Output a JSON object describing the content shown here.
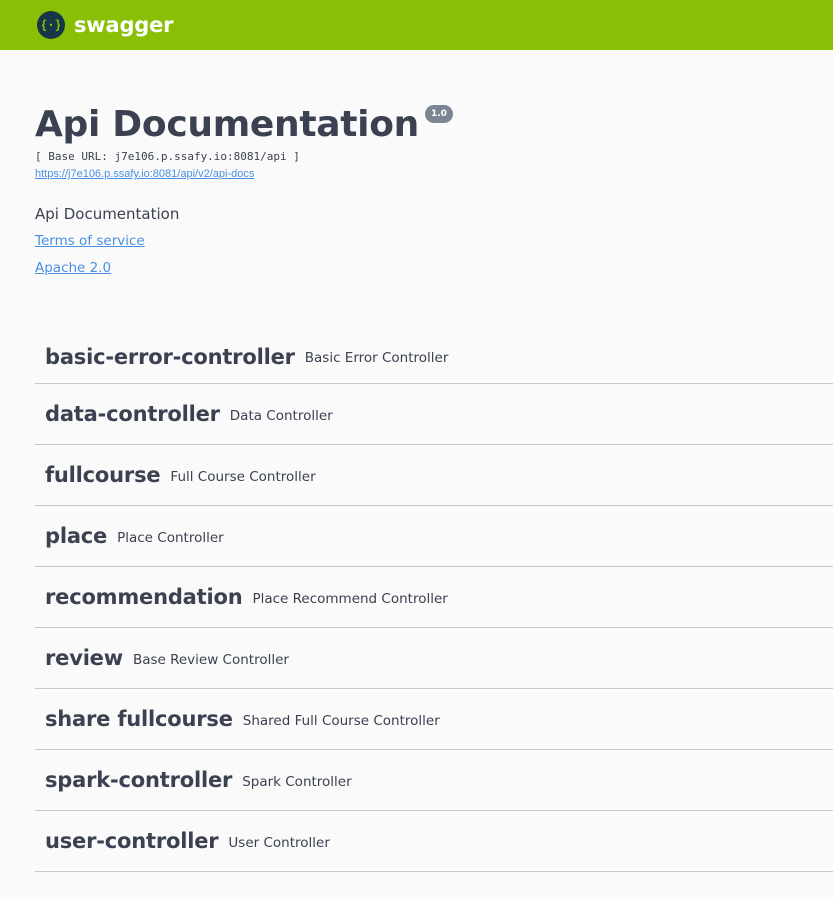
{
  "topbar": {
    "brand": "swagger",
    "logo_icon": "swagger-braces-icon",
    "colors": {
      "bar": "#89bf04",
      "logo_circle": "#173647"
    }
  },
  "info": {
    "title": "Api Documentation",
    "version": "1.0",
    "base_url": "[ Base URL: j7e106.p.ssafy.io:8081/api ]",
    "api_docs_url": "https://j7e106.p.ssafy.io:8081/api/v2/api-docs",
    "description": "Api Documentation",
    "terms_label": "Terms of service",
    "license_label": "Apache 2.0"
  },
  "tags": [
    {
      "name": "basic-error-controller",
      "description": "Basic Error Controller"
    },
    {
      "name": "data-controller",
      "description": "Data Controller"
    },
    {
      "name": "fullcourse",
      "description": "Full Course Controller"
    },
    {
      "name": "place",
      "description": "Place Controller"
    },
    {
      "name": "recommendation",
      "description": "Place Recommend Controller"
    },
    {
      "name": "review",
      "description": "Base Review Controller"
    },
    {
      "name": "share fullcourse",
      "description": "Shared Full Course Controller"
    },
    {
      "name": "spark-controller",
      "description": "Spark Controller"
    },
    {
      "name": "user-controller",
      "description": "User Controller"
    }
  ]
}
